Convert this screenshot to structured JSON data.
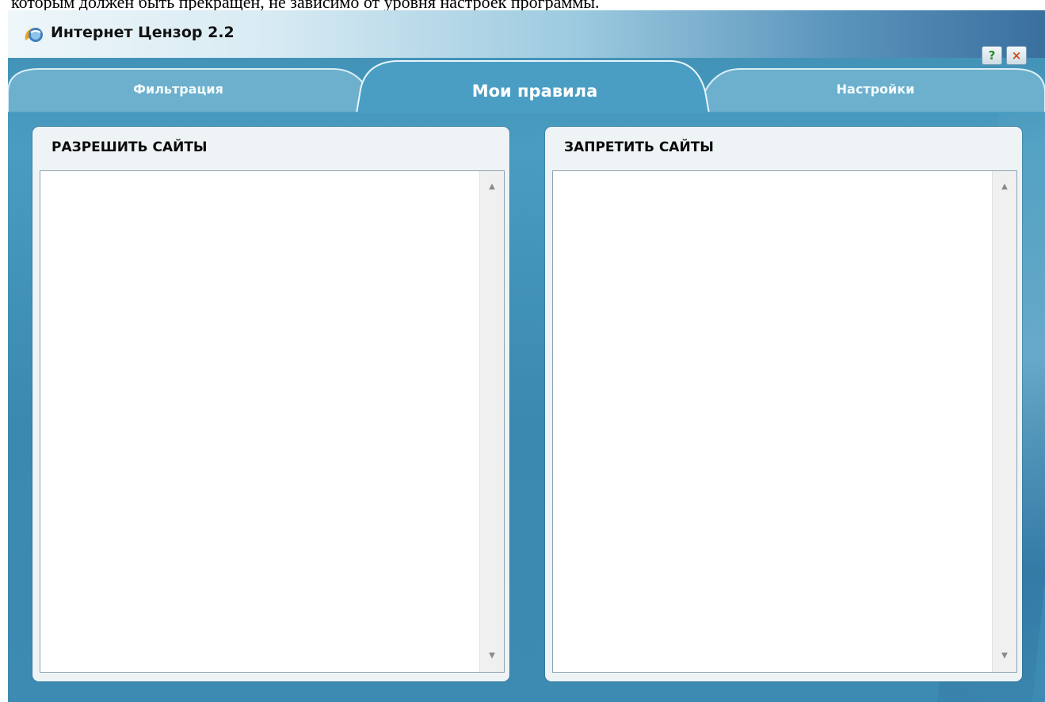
{
  "doc_line": "которым должен быть прекращен, не зависимо от уровня настроек программы.",
  "window": {
    "title": "Интернет Цензор 2.2",
    "help_label": "?",
    "close_label": "×"
  },
  "tabs": [
    {
      "label": "Фильтрация",
      "active": false
    },
    {
      "label": "Мои правила",
      "active": true
    },
    {
      "label": "Настройки",
      "active": false
    }
  ],
  "panels": {
    "allow": {
      "title": "РАЗРЕШИТЬ САЙТЫ"
    },
    "deny": {
      "title": "ЗАПРЕТИТЬ САЙТЫ"
    }
  },
  "scroll_glyphs": {
    "up": "▲",
    "down": "▼"
  },
  "colors": {
    "accent": "#3f8eb4",
    "tab_inactive": "#6db0cd",
    "tab_active": "#4a9ec4",
    "panel": "#eef3f6",
    "help_icon": "#2e8b2e",
    "close_icon": "#d04a1a"
  }
}
